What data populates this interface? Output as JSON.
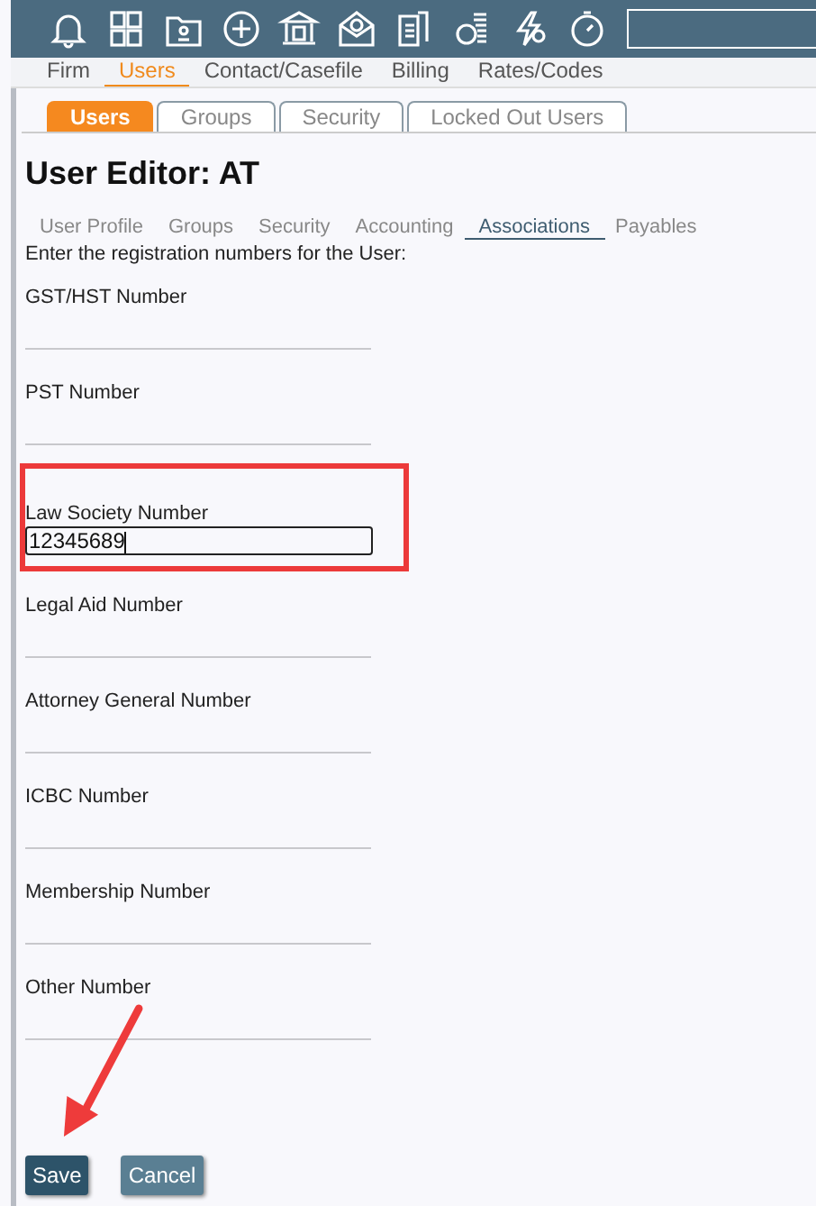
{
  "nav": [
    {
      "label": "Firm",
      "selected": false
    },
    {
      "label": "Users",
      "selected": true
    },
    {
      "label": "Contact/Casefile",
      "selected": false
    },
    {
      "label": "Billing",
      "selected": false
    },
    {
      "label": "Rates/Codes",
      "selected": false
    }
  ],
  "subtabs": [
    {
      "label": "Users",
      "selected": true
    },
    {
      "label": "Groups",
      "selected": false
    },
    {
      "label": "Security",
      "selected": false
    },
    {
      "label": "Locked Out Users",
      "selected": false
    }
  ],
  "title": "User Editor: AT",
  "tabs": [
    {
      "label": "User Profile",
      "selected": false
    },
    {
      "label": "Groups",
      "selected": false
    },
    {
      "label": "Security",
      "selected": false
    },
    {
      "label": "Accounting",
      "selected": false
    },
    {
      "label": "Associations",
      "selected": true
    },
    {
      "label": "Payables",
      "selected": false
    }
  ],
  "instruction": "Enter the registration numbers for the User:",
  "fields": [
    {
      "label": "GST/HST Number",
      "focused": false,
      "highlighted": false
    },
    {
      "label": "PST Number",
      "focused": false,
      "highlighted": false
    },
    {
      "label": "Law Society Number",
      "value": "12345689",
      "focused": true,
      "highlighted": true
    },
    {
      "label": "Legal Aid Number",
      "focused": false,
      "highlighted": false
    },
    {
      "label": "Attorney General Number",
      "focused": false,
      "highlighted": false
    },
    {
      "label": "ICBC Number",
      "focused": false,
      "highlighted": false
    },
    {
      "label": "Membership Number",
      "focused": false,
      "highlighted": false
    },
    {
      "label": "Other Number",
      "focused": false,
      "highlighted": false
    }
  ],
  "buttons": [
    {
      "label": "Save",
      "pointed": true
    },
    {
      "label": "Cancel",
      "pointed": false
    }
  ]
}
